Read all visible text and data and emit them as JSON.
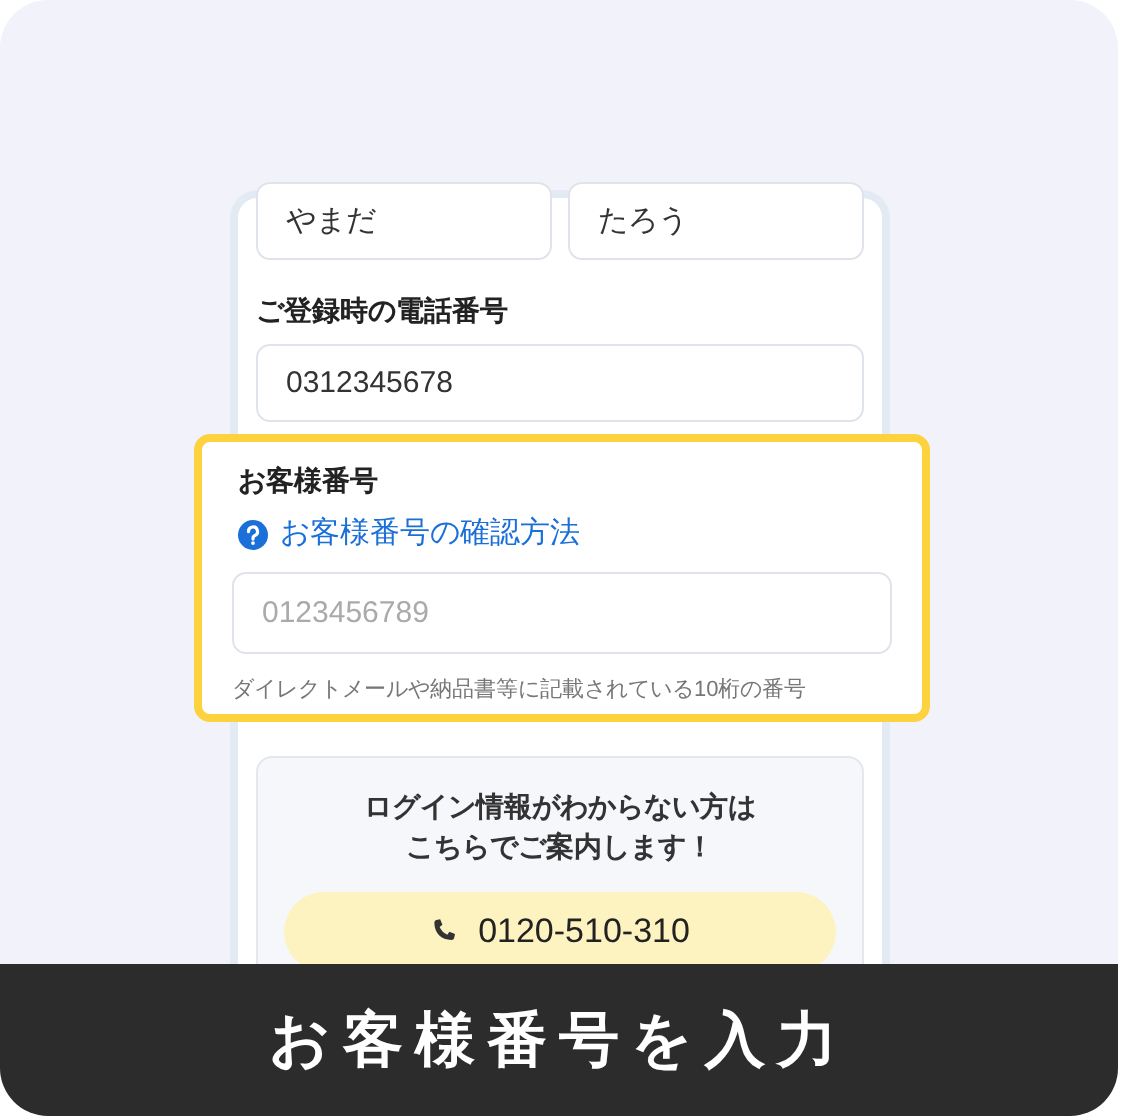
{
  "name_fields": [
    {
      "value": "やまだ"
    },
    {
      "value": "たろう"
    }
  ],
  "phone": {
    "label": "ご登録時の電話番号",
    "value": "0312345678"
  },
  "customer_number": {
    "label": "お客様番号",
    "help_link": "お客様番号の確認方法",
    "placeholder": "0123456789",
    "hint": "ダイレクトメールや納品書等に記載されている10桁の番号",
    "highlighted": true
  },
  "help_box": {
    "message_lines": [
      "ログイン情報がわからない方は",
      "こちらでご案内します！"
    ],
    "phone_button": "0120-510-310"
  },
  "caption": "お客様番号を入力"
}
